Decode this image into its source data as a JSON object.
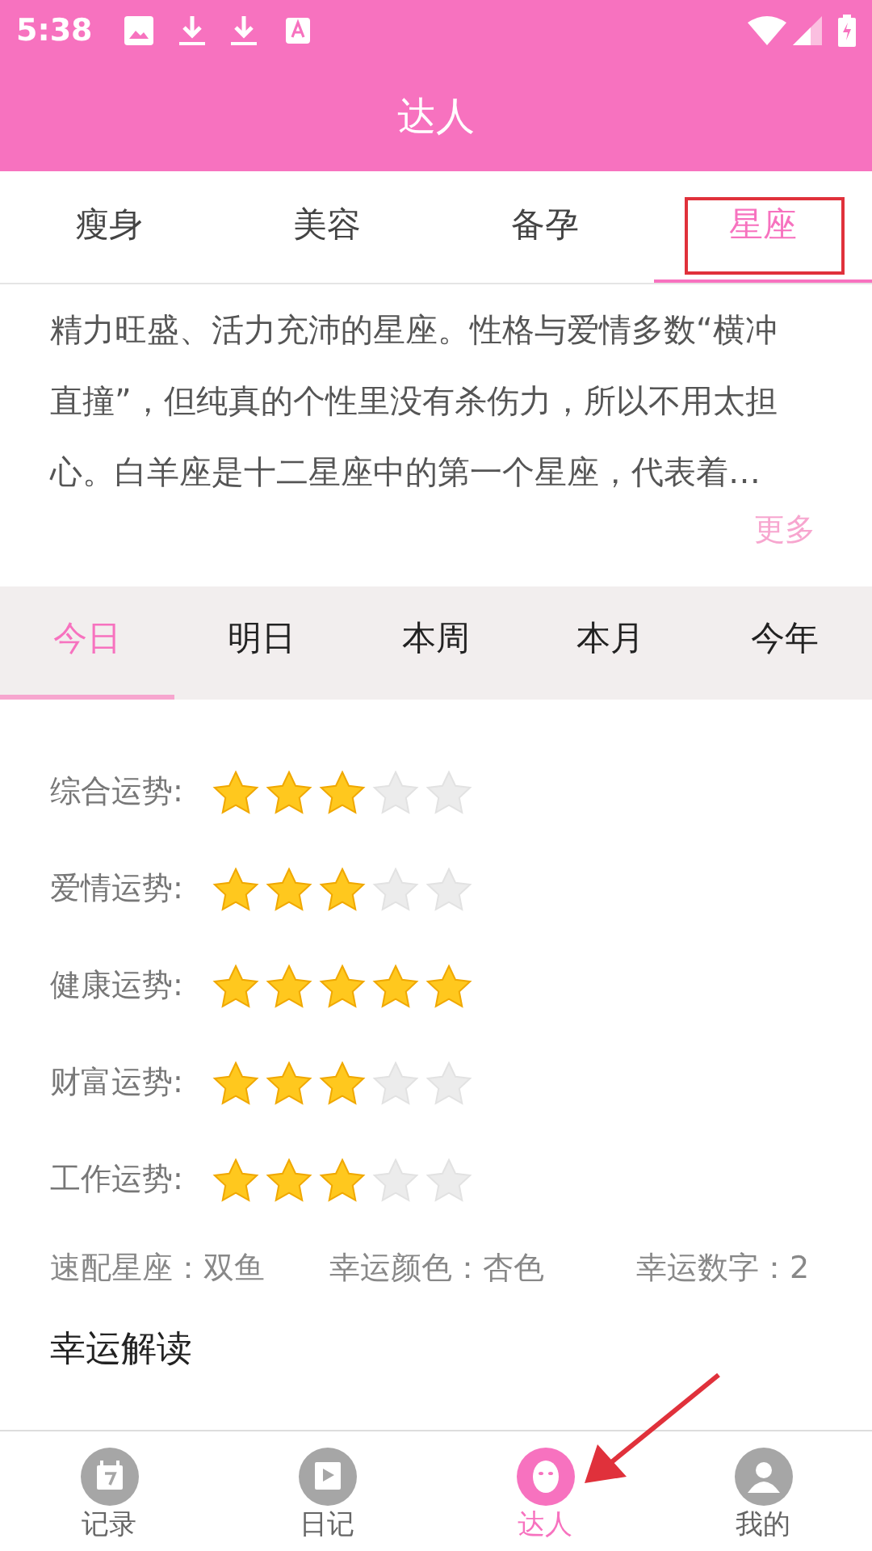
{
  "status_bar": {
    "time": "5:38"
  },
  "header": {
    "title": "达人"
  },
  "tabs": [
    {
      "label": "瘦身",
      "selected": false
    },
    {
      "label": "美容",
      "selected": false
    },
    {
      "label": "备孕",
      "selected": false
    },
    {
      "label": "星座",
      "selected": true
    }
  ],
  "description": {
    "text": "精力旺盛、活力充沛的星座。性格与爱情多数“横冲直撞”，但纯真的个性里没有杀伤力，所以不用太担心。白羊座是十二星座中的第一个星座，代表着…",
    "more": "更多"
  },
  "periods": [
    {
      "label": "今日",
      "selected": true
    },
    {
      "label": "明日",
      "selected": false
    },
    {
      "label": "本周",
      "selected": false
    },
    {
      "label": "本月",
      "selected": false
    },
    {
      "label": "今年",
      "selected": false
    }
  ],
  "fortunes": [
    {
      "label": "综合运势:",
      "stars": 3
    },
    {
      "label": "爱情运势:",
      "stars": 3
    },
    {
      "label": "健康运势:",
      "stars": 5
    },
    {
      "label": "财富运势:",
      "stars": 3
    },
    {
      "label": "工作运势:",
      "stars": 3
    }
  ],
  "info": [
    "速配星座：双鱼",
    "幸运颜色：杏色",
    "幸运数字：2"
  ],
  "section_title": "幸运解读",
  "bottom_nav": [
    {
      "label": "记录",
      "kind": "calendar",
      "selected": false
    },
    {
      "label": "日记",
      "kind": "video",
      "selected": false
    },
    {
      "label": "达人",
      "kind": "face",
      "selected": true
    },
    {
      "label": "我的",
      "kind": "person",
      "selected": false
    }
  ]
}
